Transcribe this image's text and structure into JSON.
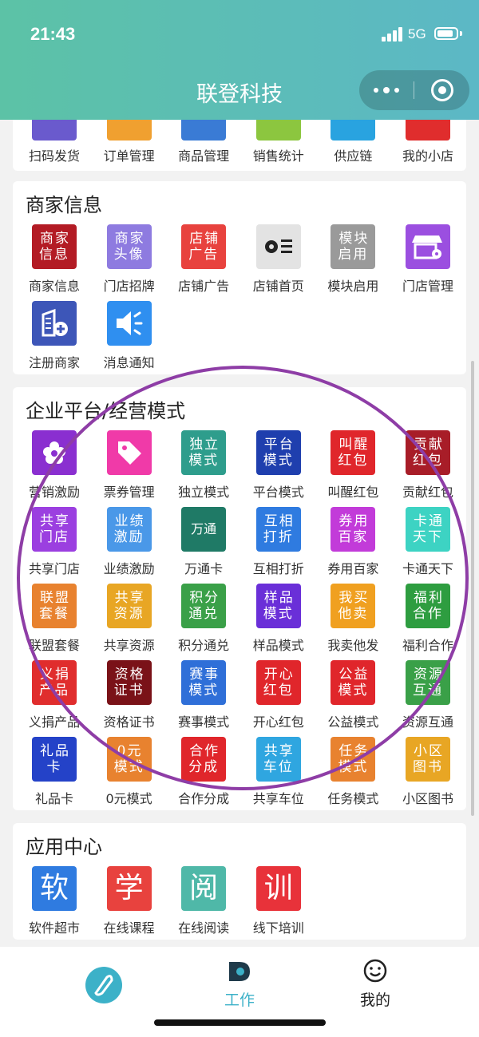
{
  "status": {
    "time": "21:43",
    "network": "5G"
  },
  "nav": {
    "title": "联登科技"
  },
  "top_row": [
    {
      "label": "扫码发货",
      "color": "#6a5acd"
    },
    {
      "label": "订单管理",
      "color": "#f0a030"
    },
    {
      "label": "商品管理",
      "color": "#3a7bd5"
    },
    {
      "label": "销售统计",
      "color": "#8cc63f"
    },
    {
      "label": "供应链",
      "color": "#29a3e0"
    },
    {
      "label": "我的小店",
      "color": "#e02d2d"
    }
  ],
  "merchant": {
    "title": "商家信息",
    "items": [
      {
        "label": "商家信息",
        "text": "商家信息",
        "color": "#b31b24"
      },
      {
        "label": "门店招牌",
        "text": "商家头像",
        "color": "#8e7be0"
      },
      {
        "label": "店铺广告",
        "text": "店铺广告",
        "color": "#e8423e"
      },
      {
        "label": "店铺首页",
        "text": "",
        "icon": "settings-list-icon",
        "color": "#e3e3e3"
      },
      {
        "label": "模块启用",
        "text": "模块启用",
        "color": "#9a9a9a"
      },
      {
        "label": "门店管理",
        "text": "",
        "icon": "store-settings-icon",
        "color": "#9b4fe0"
      },
      {
        "label": "注册商家",
        "text": "",
        "icon": "register-building-icon",
        "color": "#3d56b8"
      },
      {
        "label": "消息通知",
        "text": "",
        "icon": "speaker-icon",
        "color": "#2f8ff0"
      }
    ]
  },
  "enterprise": {
    "title": "企业平台/经营模式",
    "items": [
      {
        "label": "营销激励",
        "text": "",
        "icon": "flower-icon",
        "caption": "营销激励",
        "color": "#8a2fd0"
      },
      {
        "label": "票券管理",
        "text": "",
        "icon": "tag-icon",
        "color": "#f03aa8"
      },
      {
        "label": "独立模式",
        "text": "独立模式",
        "color": "#2e9d8c"
      },
      {
        "label": "平台模式",
        "text": "平台模式",
        "color": "#1f3fae"
      },
      {
        "label": "叫醒红包",
        "text": "叫醒红包",
        "color": "#e0262b"
      },
      {
        "label": "贡献红包",
        "text": "贡献红包",
        "color": "#a81d28"
      },
      {
        "label": "共享门店",
        "text": "共享门店",
        "color": "#9b3fe0"
      },
      {
        "label": "业绩激励",
        "text": "业绩激励",
        "color": "#4a98e8"
      },
      {
        "label": "万通卡",
        "text": "万通",
        "color": "#1f7a66"
      },
      {
        "label": "互相打折",
        "text": "互相打折",
        "color": "#2f7be0"
      },
      {
        "label": "券用百家",
        "text": "券用百家",
        "color": "#c23bd9"
      },
      {
        "label": "卡通天下",
        "text": "卡通天下",
        "color": "#3dd3c3"
      },
      {
        "label": "联盟套餐",
        "text": "联盟套餐",
        "color": "#e8822f"
      },
      {
        "label": "共享资源",
        "text": "共享资源",
        "color": "#e8a624"
      },
      {
        "label": "积分通兑",
        "text": "积分通兑",
        "color": "#3aa048"
      },
      {
        "label": "样品模式",
        "text": "样品模式",
        "color": "#6a2fd8"
      },
      {
        "label": "我卖他发",
        "text": "我买他卖",
        "color": "#f0a020"
      },
      {
        "label": "福利合作",
        "text": "福利合作",
        "color": "#2e9d40"
      },
      {
        "label": "义捐产品",
        "text": "义捐产品",
        "color": "#e02d2d"
      },
      {
        "label": "资格证书",
        "text": "资格证书",
        "color": "#7a1218"
      },
      {
        "label": "赛事模式",
        "text": "赛事模式",
        "color": "#2f6fd8"
      },
      {
        "label": "开心红包",
        "text": "开心红包",
        "color": "#e0262b"
      },
      {
        "label": "公益模式",
        "text": "公益模式",
        "color": "#e0262b"
      },
      {
        "label": "资源互通",
        "text": "资源互通",
        "color": "#3aa048"
      },
      {
        "label": "礼品卡",
        "text": "礼品卡",
        "color": "#2442c8"
      },
      {
        "label": "0元模式",
        "text": "0元模式",
        "color": "#e8822f"
      },
      {
        "label": "合作分成",
        "text": "合作分成",
        "color": "#e0262b"
      },
      {
        "label": "共享车位",
        "text": "共享车位",
        "color": "#2fa6e0"
      },
      {
        "label": "任务模式",
        "text": "任务模式",
        "color": "#e8822f"
      },
      {
        "label": "小区图书",
        "text": "小区图书",
        "color": "#e8a624"
      }
    ]
  },
  "apps": {
    "title": "应用中心",
    "items": [
      {
        "label": "软件超市",
        "text": "软",
        "color": "#2f7be0"
      },
      {
        "label": "在线课程",
        "text": "学",
        "color": "#e8423e"
      },
      {
        "label": "在线阅读",
        "text": "阅",
        "color": "#4fb8a8"
      },
      {
        "label": "线下培训",
        "text": "训",
        "color": "#e8323a"
      }
    ]
  },
  "tabbar": {
    "tabs": [
      {
        "label": "",
        "icon": "home-logo-icon"
      },
      {
        "label": "工作",
        "icon": "work-icon",
        "active": true
      },
      {
        "label": "我的",
        "icon": "smile-face-icon"
      }
    ],
    "active_color": "#3cb1c8"
  }
}
